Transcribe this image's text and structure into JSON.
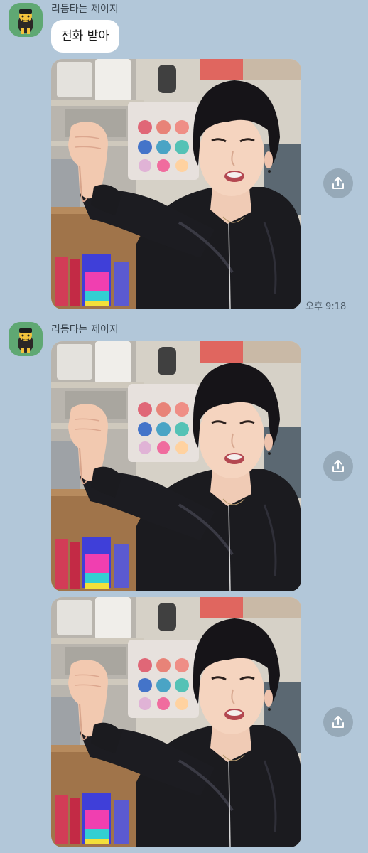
{
  "chat": {
    "messages": [
      {
        "sender": "리듬타는 제이지",
        "text": "전화 받아",
        "image_label": "thumbs-down-reaction-photo",
        "time": "오후 9:18"
      },
      {
        "sender": "리듬타는 제이지",
        "image_label": "thumbs-down-reaction-photo"
      },
      {
        "image_label": "thumbs-down-reaction-photo"
      }
    ]
  },
  "colors": {
    "background": "#b2c7d9",
    "bubble": "#ffffff",
    "avatar_bg": "#5fa873",
    "share_button": "#96a9b8"
  },
  "icons": {
    "share": "share-upload-icon",
    "avatar": "cartoon-character-avatar"
  }
}
